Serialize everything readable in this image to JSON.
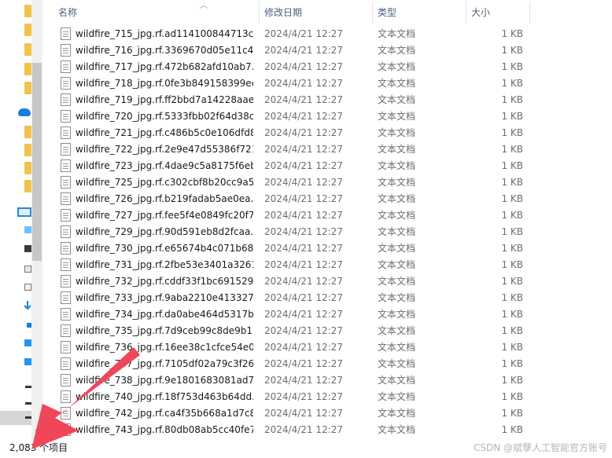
{
  "header": {
    "name": "名称",
    "date": "修改日期",
    "type": "类型",
    "size": "大小"
  },
  "files": [
    {
      "name": "wildfire_715_jpg.rf.ad114100844713c...",
      "date": "2024/4/21 12:27",
      "type": "文本文档",
      "size": "1 KB"
    },
    {
      "name": "wildfire_716_jpg.rf.3369670d05e11c4...",
      "date": "2024/4/21 12:27",
      "type": "文本文档",
      "size": "1 KB"
    },
    {
      "name": "wildfire_717_jpg.rf.472b682afd10ab7...",
      "date": "2024/4/21 12:27",
      "type": "文本文档",
      "size": "1 KB"
    },
    {
      "name": "wildfire_718_jpg.rf.0fe3b849158399ee...",
      "date": "2024/4/21 12:27",
      "type": "文本文档",
      "size": "1 KB"
    },
    {
      "name": "wildfire_719_jpg.rf.ff2bbd7a14228aae...",
      "date": "2024/4/21 12:27",
      "type": "文本文档",
      "size": "1 KB"
    },
    {
      "name": "wildfire_720_jpg.rf.5333fbb02f64d38c...",
      "date": "2024/4/21 12:27",
      "type": "文本文档",
      "size": "1 KB"
    },
    {
      "name": "wildfire_721_jpg.rf.c486b5c0e106dfd8...",
      "date": "2024/4/21 12:27",
      "type": "文本文档",
      "size": "1 KB"
    },
    {
      "name": "wildfire_722_jpg.rf.2e9e47d55386f721...",
      "date": "2024/4/21 12:27",
      "type": "文本文档",
      "size": "1 KB"
    },
    {
      "name": "wildfire_723_jpg.rf.4dae9c5a8175f6eb...",
      "date": "2024/4/21 12:27",
      "type": "文本文档",
      "size": "1 KB"
    },
    {
      "name": "wildfire_725_jpg.rf.c302cbf8b20cc9a5...",
      "date": "2024/4/21 12:27",
      "type": "文本文档",
      "size": "1 KB"
    },
    {
      "name": "wildfire_726_jpg.rf.b219fadab5ae0ea...",
      "date": "2024/4/21 12:27",
      "type": "文本文档",
      "size": "1 KB"
    },
    {
      "name": "wildfire_727_jpg.rf.fee5f4e0849fc20f7...",
      "date": "2024/4/21 12:27",
      "type": "文本文档",
      "size": "1 KB"
    },
    {
      "name": "wildfire_729_jpg.rf.90d591eb8d2fcaa...",
      "date": "2024/4/21 12:27",
      "type": "文本文档",
      "size": "1 KB"
    },
    {
      "name": "wildfire_730_jpg.rf.e65674b4c071b68...",
      "date": "2024/4/21 12:27",
      "type": "文本文档",
      "size": "1 KB"
    },
    {
      "name": "wildfire_731_jpg.rf.2fbe53e3401a3261...",
      "date": "2024/4/21 12:27",
      "type": "文本文档",
      "size": "1 KB"
    },
    {
      "name": "wildfire_732_jpg.rf.cddf33f1bc691529...",
      "date": "2024/4/21 12:27",
      "type": "文本文档",
      "size": "1 KB"
    },
    {
      "name": "wildfire_733_jpg.rf.9aba2210e413327...",
      "date": "2024/4/21 12:27",
      "type": "文本文档",
      "size": "1 KB"
    },
    {
      "name": "wildfire_734_jpg.rf.da0abe464d5317b...",
      "date": "2024/4/21 12:27",
      "type": "文本文档",
      "size": "1 KB"
    },
    {
      "name": "wildfire_735_jpg.rf.7d9ceb99c8de9b1...",
      "date": "2024/4/21 12:27",
      "type": "文本文档",
      "size": "1 KB"
    },
    {
      "name": "wildfire_736_jpg.rf.16ee38c1cfce54e0...",
      "date": "2024/4/21 12:27",
      "type": "文本文档",
      "size": "1 KB"
    },
    {
      "name": "wildfire_737_jpg.rf.7105df02a79c3f26...",
      "date": "2024/4/21 12:27",
      "type": "文本文档",
      "size": "1 KB"
    },
    {
      "name": "wildfire_738_jpg.rf.9e1801683081ad7...",
      "date": "2024/4/21 12:27",
      "type": "文本文档",
      "size": "1 KB"
    },
    {
      "name": "wildfire_740_jpg.rf.18f753d463b64dd...",
      "date": "2024/4/21 12:27",
      "type": "文本文档",
      "size": "1 KB"
    },
    {
      "name": "wildfire_742_jpg.rf.ca4f35b668a1d7c8...",
      "date": "2024/4/21 12:27",
      "type": "文本文档",
      "size": "1 KB"
    },
    {
      "name": "wildfire_743_jpg.rf.80db08ab5cc40fe7...",
      "date": "2024/4/21 12:27",
      "type": "文本文档",
      "size": "1 KB"
    }
  ],
  "status": {
    "item_count": "2,083 个项目"
  },
  "watermark": "CSDN @斌孽人工智能官方账号",
  "colors": {
    "annotation_arrow": "#f0465a",
    "header_text": "#4c607a"
  },
  "icons": {
    "file": "text-document-icon",
    "nav_folder": "folder-icon",
    "nav_cloud": "onedrive-cloud-icon",
    "nav_pc": "this-pc-icon"
  }
}
